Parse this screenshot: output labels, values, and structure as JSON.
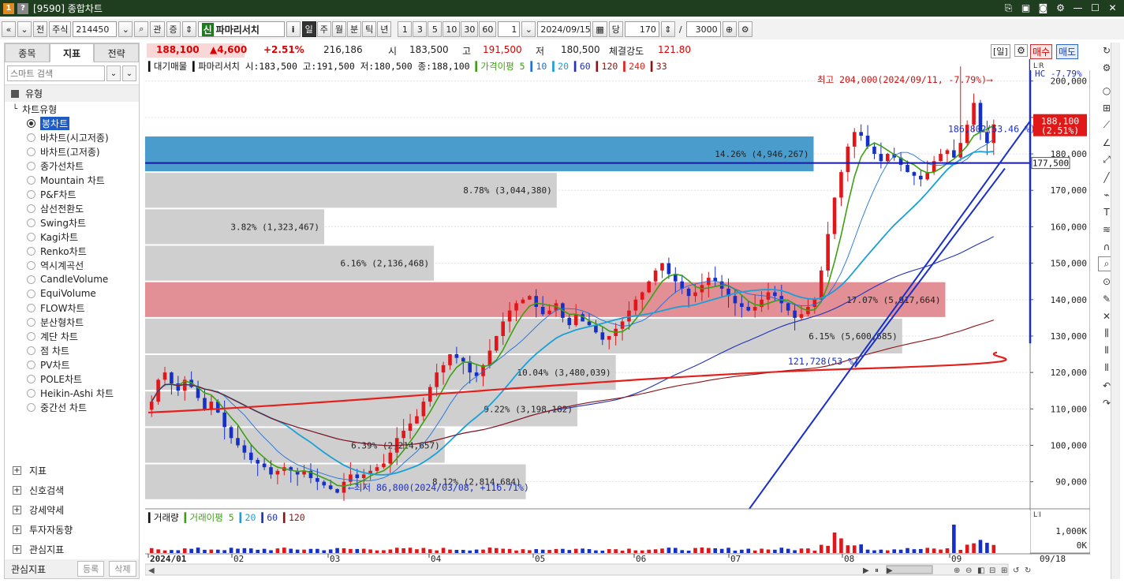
{
  "window": {
    "title": "[9590] 종합차트",
    "icon_1": "1",
    "icon_2": "?"
  },
  "toolbar": {
    "segment_label": "전",
    "market": "주식",
    "code": "214450",
    "btn_gwan": "관",
    "btn_jeung": "증",
    "badge": "신",
    "stock_name": "파마리서치",
    "info_btn": "i",
    "periods": [
      "일",
      "주",
      "월",
      "분",
      "틱",
      "년"
    ],
    "active_period": "일",
    "intervals": [
      "1",
      "3",
      "5",
      "10",
      "30",
      "60"
    ],
    "interval_value": "1",
    "date": "2024/09/15",
    "dang_label": "당",
    "count": "170",
    "slash": "/",
    "total": "3000"
  },
  "left_panel": {
    "tabs": [
      "종목",
      "지표",
      "전략"
    ],
    "active_tab": "지표",
    "search_placeholder": "스마트 검색",
    "section_type": "유형",
    "subhead": "차트유형",
    "chart_types": [
      "봉차트",
      "바차트(시고저종)",
      "바차트(고저종)",
      "종가선차트",
      "Mountain 차트",
      "P&F차트",
      "삼선전환도",
      "Swing차트",
      "Kagi차트",
      "Renko차트",
      "역시계곡선",
      "CandleVolume",
      "EquiVolume",
      "FLOW차트",
      "분산형차트",
      "계단 차트",
      "점 차트",
      "PV차트",
      "POLE차트",
      "Heikin-Ashi 차트",
      "중간선 차트"
    ],
    "selected_type": "봉차트",
    "bottom_sections": [
      "지표",
      "신호검색",
      "강세약세",
      "투자자동향",
      "관심지표"
    ],
    "footer_label": "관심지표",
    "footer_register": "등록",
    "footer_delete": "삭제"
  },
  "price_bar": {
    "current": "188,100",
    "change": "▲4,600",
    "change_pct": "+2.51%",
    "volume": "216,186",
    "open_label": "시",
    "open": "183,500",
    "high_label": "고",
    "high": "191,500",
    "low_label": "저",
    "low": "180,500",
    "strength_label": "체결강도",
    "strength": "121.80",
    "day_btn": "[일]",
    "buy_btn": "매수",
    "sell_btn": "매도"
  },
  "chart_data": {
    "type": "candlestick",
    "legend_main": "대기매물",
    "legend_ohlc": "파마리서치 시:183,500 고:191,500 저:180,500 종:188,100",
    "legend_ma_label": "가격이평 5",
    "legend_ma_periods": [
      "10",
      "20",
      "60",
      "120",
      "240",
      "33"
    ],
    "volume_legend": "거래량",
    "volume_ma_label": "거래이평 5",
    "volume_ma_periods": [
      "20",
      "60",
      "120"
    ],
    "y_ticks": [
      "200,000",
      "190,000",
      "180,000",
      "170,000",
      "160,000",
      "150,000",
      "140,000",
      "130,000",
      "120,000",
      "110,000",
      "100,000",
      "90,000"
    ],
    "y_min": 83000,
    "y_max": 206000,
    "volume_ticks": [
      "1,000K",
      "0K"
    ],
    "x_labels": [
      "2024/01",
      "02",
      "03",
      "04",
      "05",
      "06",
      "07",
      "08",
      "09"
    ],
    "x_last": "09/18",
    "right_labels": {
      "hc": "HC  -7.79%",
      "current_price": "188,100",
      "current_pct": "(2.51%)",
      "support": "177,500"
    },
    "annotations": {
      "high": "최고 204,000(2024/09/11, -7.79%)",
      "low": "최저 86,800(2024/03/08, +116.71%)",
      "fib_top": "186,802(53.46 %)",
      "fib_low": "121,728(53 %)"
    },
    "supply_zones": [
      {
        "label": "14.26% (4,946,267)",
        "pct": 14.26,
        "lo": 175000,
        "hi": 185000,
        "color": "#4a9ccc"
      },
      {
        "label": "8.78% (3,044,380)",
        "pct": 8.78,
        "lo": 165000,
        "hi": 175000,
        "color": "#cfcfcf"
      },
      {
        "label": "3.82% (1,323,467)",
        "pct": 3.82,
        "lo": 155000,
        "hi": 165000,
        "color": "#cfcfcf"
      },
      {
        "label": "6.16% (2,136,468)",
        "pct": 6.16,
        "lo": 145000,
        "hi": 155000,
        "color": "#cfcfcf"
      },
      {
        "label": "17.07% (5,917,664)",
        "pct": 17.07,
        "lo": 135000,
        "hi": 145000,
        "color": "#e28f96"
      },
      {
        "label": "6.15% (5,600,685)",
        "pct": 16.15,
        "lo": 125000,
        "hi": 135000,
        "color": "#cfcfcf"
      },
      {
        "label": "10.04% (3,480,039)",
        "pct": 10.04,
        "lo": 115000,
        "hi": 125000,
        "color": "#cfcfcf"
      },
      {
        "label": "9.22% (3,198,182)",
        "pct": 9.22,
        "lo": 105000,
        "hi": 115000,
        "color": "#cfcfcf"
      },
      {
        "label": "6.39% (2,214,657)",
        "pct": 6.39,
        "lo": 95000,
        "hi": 105000,
        "color": "#cfcfcf"
      },
      {
        "label": "8.12% (2,814,684)",
        "pct": 8.12,
        "lo": 85000,
        "hi": 95000,
        "color": "#cfcfcf"
      }
    ],
    "closes": [
      112000,
      118000,
      120000,
      117000,
      115000,
      118000,
      116000,
      113000,
      110000,
      112000,
      109000,
      105000,
      102000,
      100000,
      98000,
      96000,
      95000,
      94000,
      92000,
      93000,
      94000,
      93000,
      92000,
      93000,
      91000,
      90000,
      89000,
      88000,
      87000,
      90000,
      92000,
      91000,
      92000,
      93000,
      94000,
      95000,
      98000,
      102000,
      104000,
      106000,
      108000,
      112000,
      116000,
      120000,
      122000,
      125000,
      124000,
      123000,
      120000,
      119000,
      122000,
      126000,
      130000,
      134000,
      137000,
      139000,
      140000,
      141000,
      138000,
      136000,
      137000,
      139000,
      135000,
      133000,
      136000,
      134000,
      133000,
      131000,
      129000,
      130000,
      132000,
      134000,
      137000,
      140000,
      142000,
      145000,
      148000,
      150000,
      147000,
      145000,
      143000,
      141000,
      142000,
      144000,
      146000,
      145000,
      143000,
      141000,
      139000,
      138000,
      137000,
      138000,
      140000,
      142000,
      141000,
      139000,
      137000,
      135000,
      136000,
      138000,
      140000,
      148000,
      158000,
      168000,
      175000,
      182000,
      186000,
      185000,
      182000,
      180000,
      178000,
      180000,
      179000,
      177000,
      175000,
      174000,
      173000,
      175000,
      178000,
      180000,
      181000,
      179000,
      183000,
      188000,
      194000,
      186000,
      183000,
      188100
    ]
  }
}
